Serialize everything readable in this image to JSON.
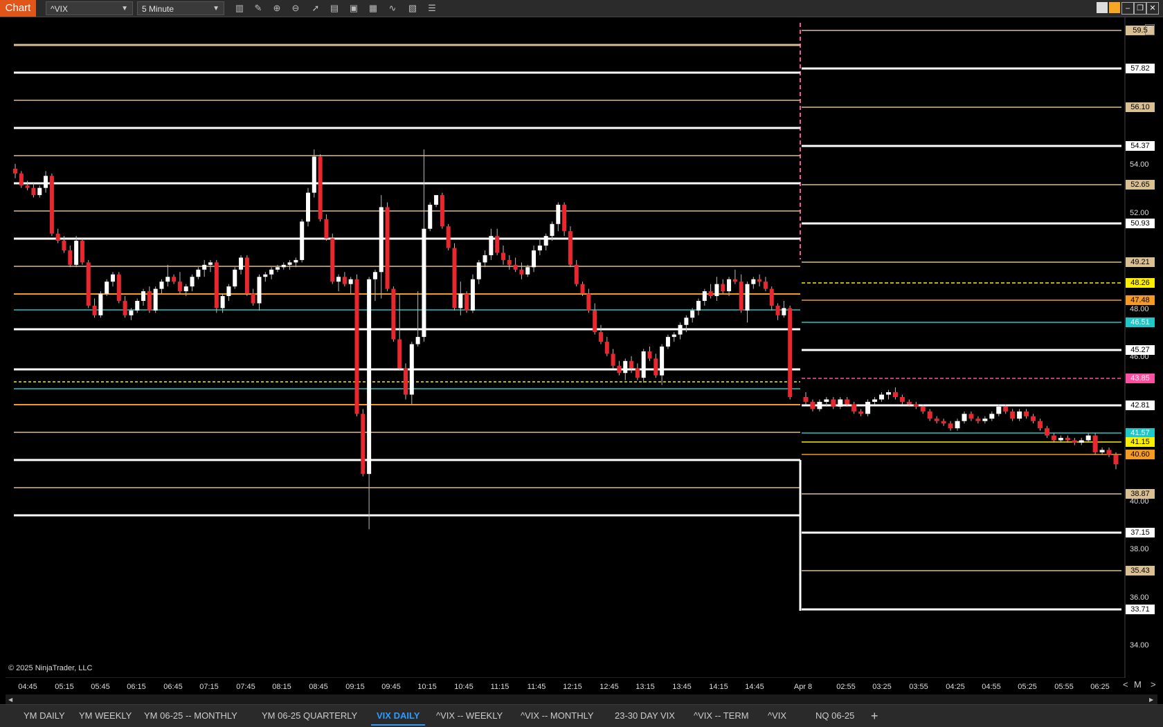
{
  "toolbar": {
    "chart_tab": "Chart",
    "instrument": "^VIX",
    "interval": "5 Minute",
    "icons": [
      "bar-type-icon",
      "draw-icon",
      "zoom-in-icon",
      "zoom-out-icon",
      "pointer-icon",
      "template-icon",
      "panel-icon",
      "data-box-icon",
      "strategy-icon",
      "properties-icon",
      "list-icon"
    ],
    "window_buttons": [
      "color-a",
      "color-b",
      "minimize",
      "restore",
      "maximize",
      "close"
    ]
  },
  "chart": {
    "copyright": "© 2025 NinjaTrader, LLC",
    "f_button": "F",
    "scroll_nav": [
      "<",
      "M",
      ">"
    ],
    "axis_ticks": [
      "54.00",
      "52.00",
      "50.00",
      "48.00",
      "46.00",
      "42.00",
      "40.00",
      "38.00",
      "36.00",
      "34.00"
    ],
    "price_levels": [
      {
        "label": "59.5",
        "bg": "#d9bf92",
        "fg": "#000"
      },
      {
        "label": "57.82",
        "bg": "#ffffff",
        "fg": "#000"
      },
      {
        "label": "56.10",
        "bg": "#d9bf92",
        "fg": "#000"
      },
      {
        "label": "54.37",
        "bg": "#ffffff",
        "fg": "#000"
      },
      {
        "label": "52.65",
        "bg": "#d9bf92",
        "fg": "#000"
      },
      {
        "label": "50.93",
        "bg": "#ffffff",
        "fg": "#000"
      },
      {
        "label": "49.21",
        "bg": "#d9bf92",
        "fg": "#000"
      },
      {
        "label": "48.26",
        "bg": "#ffee00",
        "fg": "#000"
      },
      {
        "label": "47.48",
        "bg": "#f59a23",
        "fg": "#000"
      },
      {
        "label": "46.51",
        "bg": "#1ec8c8",
        "fg": "#fff"
      },
      {
        "label": "45.27",
        "bg": "#ffffff",
        "fg": "#000"
      },
      {
        "label": "43.85",
        "bg": "#ff4fa3",
        "fg": "#fff"
      },
      {
        "label": "42.81",
        "bg": "#ffffff",
        "fg": "#000"
      },
      {
        "label": "41.57",
        "bg": "#1ec8c8",
        "fg": "#fff"
      },
      {
        "label": "41.15",
        "bg": "#ffee00",
        "fg": "#000"
      },
      {
        "label": "40.60",
        "bg": "#f59a23",
        "fg": "#000"
      },
      {
        "label": "38.87",
        "bg": "#d9bf92",
        "fg": "#000"
      },
      {
        "label": "37.15",
        "bg": "#ffffff",
        "fg": "#000"
      },
      {
        "label": "35.43",
        "bg": "#d9bf92",
        "fg": "#000"
      },
      {
        "label": "33.71",
        "bg": "#ffffff",
        "fg": "#000"
      }
    ],
    "time_labels": [
      "04:45",
      "05:15",
      "05:45",
      "06:15",
      "06:45",
      "07:15",
      "07:45",
      "08:15",
      "08:45",
      "09:15",
      "09:45",
      "10:15",
      "10:45",
      "11:15",
      "11:45",
      "12:15",
      "12:45",
      "13:15",
      "13:45",
      "14:15",
      "14:45",
      "Apr 8",
      "02:55",
      "03:25",
      "03:55",
      "04:25",
      "04:55",
      "05:25",
      "05:55",
      "06:25"
    ]
  },
  "tabs": [
    {
      "label": "YM DAILY",
      "active": false
    },
    {
      "label": "YM WEEKLY",
      "active": false
    },
    {
      "label": "YM 06-25 -- MONTHLY",
      "active": false
    },
    {
      "label": "YM 06-25 QUARTERLY",
      "active": false
    },
    {
      "label": "VIX DAILY",
      "active": true
    },
    {
      "label": "^VIX -- WEEKLY",
      "active": false
    },
    {
      "label": "^VIX -- MONTHLY",
      "active": false
    },
    {
      "label": "23-30 DAY VIX",
      "active": false
    },
    {
      "label": "^VIX -- TERM",
      "active": false
    },
    {
      "label": "^VIX",
      "active": false
    },
    {
      "label": "NQ 06-25",
      "active": false
    }
  ],
  "add_tab": "+",
  "colors": {
    "up": "#ffffff",
    "down": "#e8272e",
    "white_level": "#ffffff",
    "tan_level": "#d9bf92",
    "orange_level": "#f59a23",
    "cyan_level": "#1ec8c8",
    "yellow_level": "#ffee00",
    "pink_level": "#ff4fa3"
  }
}
